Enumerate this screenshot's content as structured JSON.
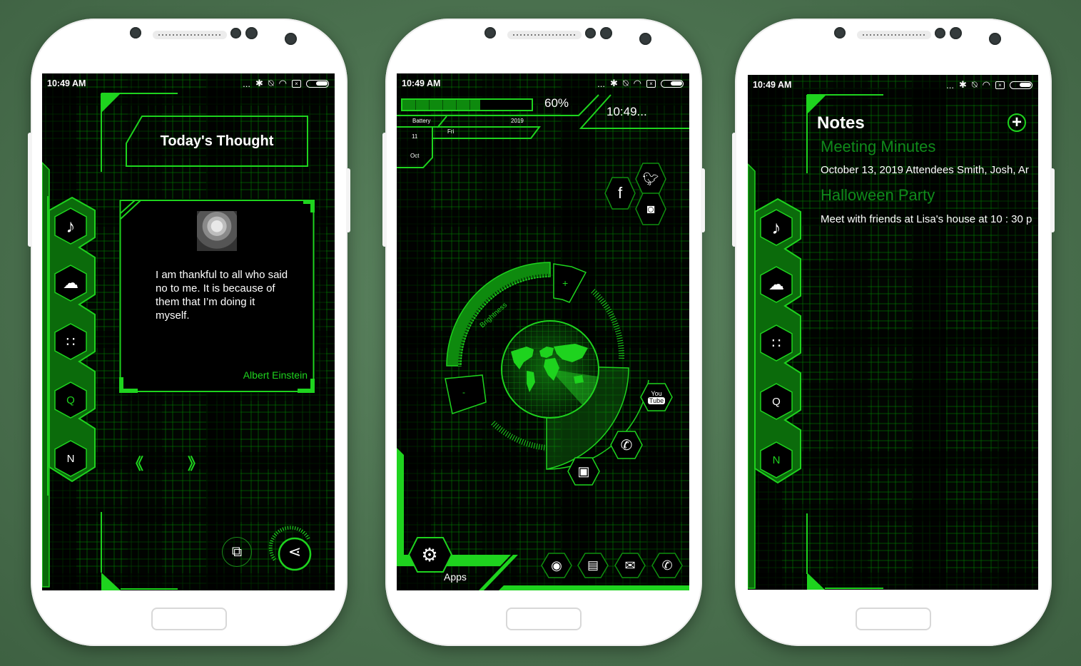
{
  "status_bar": {
    "time": "10:49 AM",
    "dots": "..."
  },
  "phone1": {
    "widget_title": "Today's Thought",
    "quote": "I am thankful to all who said no to me. It is because of them that I’m doing it myself.",
    "author": "Albert Einstein",
    "nav_prev": "《",
    "nav_next": "》",
    "dock": [
      {
        "icon": "music-note-icon",
        "glyph": "♪"
      },
      {
        "icon": "weather-icon",
        "glyph": "☁"
      },
      {
        "icon": "dialpad-icon",
        "glyph": "∷"
      },
      {
        "icon": "q-icon",
        "glyph": "Q"
      },
      {
        "icon": "n-icon",
        "glyph": "N"
      }
    ]
  },
  "phone2": {
    "battery_percent": "60%",
    "battery_level": 0.6,
    "clock": "10:49...",
    "battery_label": "Battery",
    "year": "2019",
    "day_name": "Fri",
    "day_number": "11",
    "month": "Oct",
    "brightness_label": "Brightness",
    "brightness_plus": "+",
    "brightness_minus": "-",
    "social": {
      "facebook": "f"
    },
    "youtube_you": "You",
    "youtube_tube": "Tube",
    "apps_label": "Apps",
    "dock_apps": [
      "chrome-icon",
      "messages-icon",
      "email-icon",
      "phone-icon"
    ]
  },
  "phone3": {
    "title": "Notes",
    "add_glyph": "+",
    "notes": [
      {
        "title": "Meeting Minutes",
        "preview": "October 13, 2019 Attendees Smith, Josh, Ar"
      },
      {
        "title": "Halloween Party",
        "preview": "Meet with friends at Lisa's house at 10 : 30 p"
      }
    ]
  },
  "colors": {
    "accent": "#1ed31e",
    "dim_green": "#0d7a0d",
    "background": "#4b714f"
  }
}
